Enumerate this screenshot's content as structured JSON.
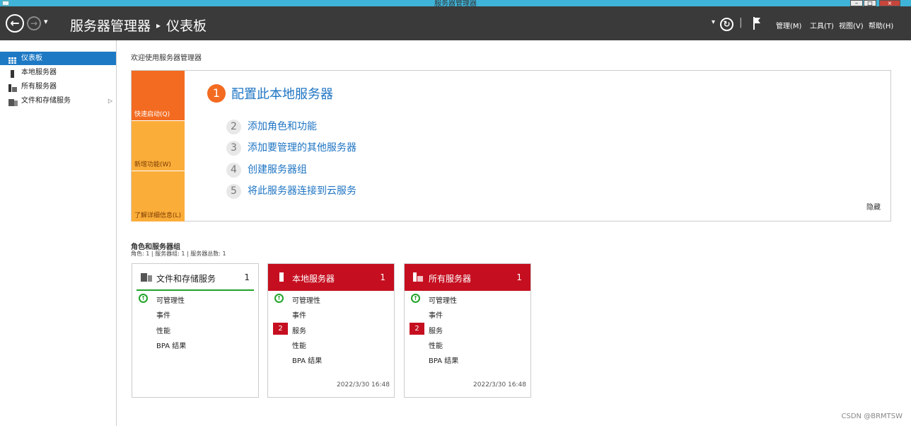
{
  "window": {
    "title": "服务器管理器",
    "minimize": "–",
    "maximize": "□",
    "close": "×"
  },
  "header": {
    "app": "服务器管理器",
    "separator": "▸",
    "page": "仪表板",
    "nav_back": "←",
    "nav_forward": "→",
    "dropdown": "▾",
    "refresh_dropdown": "▾",
    "refresh_icon": "↻",
    "divider": "|",
    "menus": [
      "管理(M)",
      "工具(T)",
      "视图(V)",
      "帮助(H)"
    ]
  },
  "sidebar": {
    "items": [
      {
        "label": "仪表板",
        "icon": "dashboard-grid-icon",
        "selected": true
      },
      {
        "label": "本地服务器",
        "icon": "server-icon"
      },
      {
        "label": "所有服务器",
        "icon": "servers-icon"
      },
      {
        "label": "文件和存储服务",
        "icon": "file-storage-icon",
        "expand": "▷"
      }
    ]
  },
  "welcome_title": "欢迎使用服务器管理器",
  "quickstart": {
    "tiles": [
      "快速启动(Q)",
      "新增功能(W)",
      "了解详细信息(L)"
    ],
    "steps": [
      {
        "num": "1",
        "label": "配置此本地服务器"
      },
      {
        "num": "2",
        "label": "添加角色和功能"
      },
      {
        "num": "3",
        "label": "添加要管理的其他服务器"
      },
      {
        "num": "4",
        "label": "创建服务器组"
      },
      {
        "num": "5",
        "label": "将此服务器连接到云服务"
      }
    ],
    "hide": "隐藏"
  },
  "roles": {
    "title": "角色和服务器组",
    "subtitle": "角色: 1 | 服务器组: 1 | 服务器总数: 1",
    "cards": [
      {
        "title": "文件和存储服务",
        "count": "1",
        "rows": [
          "可管理性",
          "事件",
          "性能",
          "BPA 结果"
        ],
        "timestamp": ""
      },
      {
        "title": "本地服务器",
        "count": "1",
        "rows": [
          "可管理性",
          "事件",
          "服务",
          "性能",
          "BPA 结果"
        ],
        "service_badge": "2",
        "timestamp": "2022/3/30 16:48"
      },
      {
        "title": "所有服务器",
        "count": "1",
        "rows": [
          "可管理性",
          "事件",
          "服务",
          "性能",
          "BPA 结果"
        ],
        "service_badge": "2",
        "timestamp": "2022/3/30 16:48"
      }
    ]
  },
  "watermark": "CSDN @BRMTSW",
  "colors": {
    "accent": "#1e79c4",
    "header_bg": "#3a3a3a",
    "tile_orange": "#f36b21",
    "tile_amber": "#fbad3a",
    "card_red": "#c50f20",
    "ok_green": "#21a32a"
  }
}
